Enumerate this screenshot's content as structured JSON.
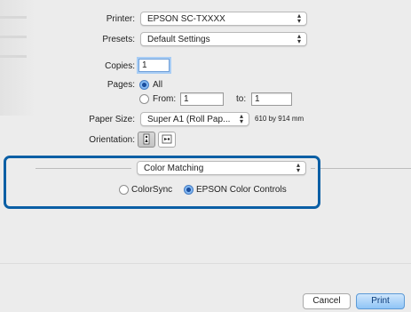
{
  "printer": {
    "label": "Printer:",
    "value": "EPSON SC-TXXXX"
  },
  "presets": {
    "label": "Presets:",
    "value": "Default Settings"
  },
  "copies": {
    "label": "Copies:",
    "value": "1"
  },
  "pages": {
    "label": "Pages:",
    "all_label": "All",
    "from_label": "From:",
    "from_value": "1",
    "to_label": "to:",
    "to_value": "1",
    "selected": "All"
  },
  "paper_size": {
    "label": "Paper Size:",
    "value": "Super A1 (Roll Pap...",
    "dimensions": "610 by 914 mm"
  },
  "orientation": {
    "label": "Orientation:",
    "selected": "portrait"
  },
  "panel": {
    "value": "Color Matching"
  },
  "color_matching": {
    "option1": "ColorSync",
    "option2": "EPSON Color Controls",
    "selected": "EPSON Color Controls"
  },
  "buttons": {
    "cancel": "Cancel",
    "print": "Print"
  },
  "colors": {
    "highlight": "#0b5fa5",
    "accent": "#5b9be6"
  },
  "icons": {
    "updown": "updown-arrows-icon",
    "portrait": "portrait-orientation-icon",
    "landscape": "landscape-orientation-icon",
    "disclosure": "disclosure-dash-icon"
  }
}
